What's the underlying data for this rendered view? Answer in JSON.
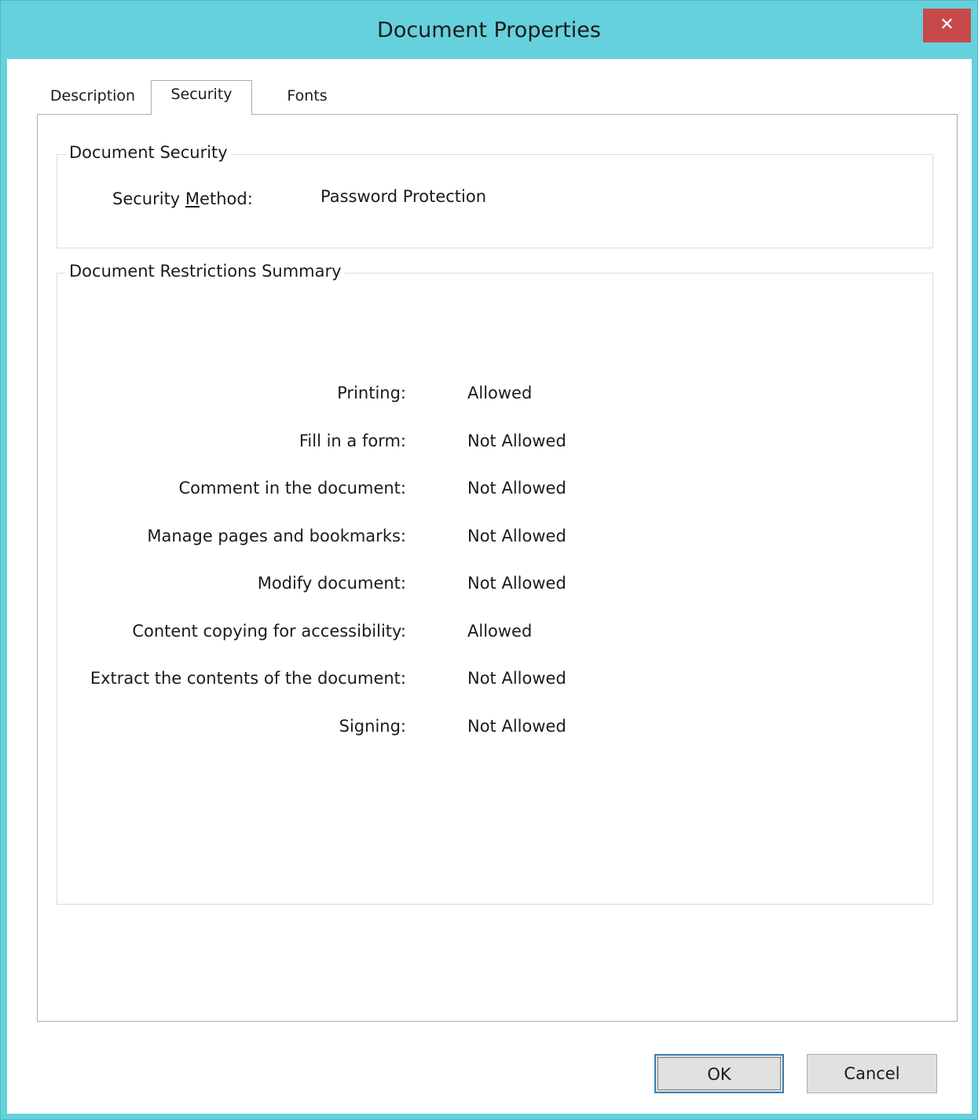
{
  "window": {
    "title": "Document Properties",
    "close_glyph": "✕",
    "colors": {
      "frame": "#65d1dd",
      "close_button": "#c74a4a",
      "focus_border": "#3c7fb1"
    }
  },
  "tabs": [
    {
      "label": "Description",
      "selected": false
    },
    {
      "label": "Security",
      "selected": true
    },
    {
      "label": "Fonts",
      "selected": false
    }
  ],
  "document_security": {
    "legend": "Document Security",
    "method_label_pre": "Security ",
    "method_label_mnemonic": "M",
    "method_label_post": "ethod:",
    "method_value": "Password Protection"
  },
  "restrictions": {
    "legend": "Document Restrictions Summary",
    "rows": [
      {
        "label": "Printing:",
        "value": "Allowed"
      },
      {
        "label": "Fill in a form:",
        "value": "Not Allowed"
      },
      {
        "label": "Comment in the document:",
        "value": "Not Allowed"
      },
      {
        "label": "Manage pages and bookmarks:",
        "value": "Not Allowed"
      },
      {
        "label": "Modify document:",
        "value": "Not Allowed"
      },
      {
        "label": "Content copying for accessibility:",
        "value": "Allowed"
      },
      {
        "label": "Extract the contents of the document:",
        "value": "Not Allowed"
      },
      {
        "label": "Signing:",
        "value": "Not Allowed"
      }
    ]
  },
  "buttons": {
    "ok_label": "OK",
    "cancel_label": "Cancel"
  }
}
